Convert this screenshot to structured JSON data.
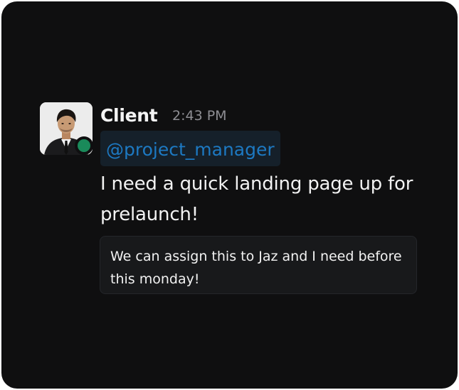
{
  "message": {
    "sender": "Client",
    "time": "2:43 PM",
    "mention": "@project_manager",
    "text": "I need a quick landing page up for prelaunch!",
    "quote": "We can assign this to Jaz and I need before this monday!",
    "presence_status": "online"
  },
  "colors": {
    "background": "#0f0f10",
    "mention_text": "#1d79c2",
    "mention_bg": "#15202a",
    "presence": "#1a8a5a"
  },
  "icons": {
    "avatar": "user-avatar",
    "presence": "online-dot-icon"
  }
}
